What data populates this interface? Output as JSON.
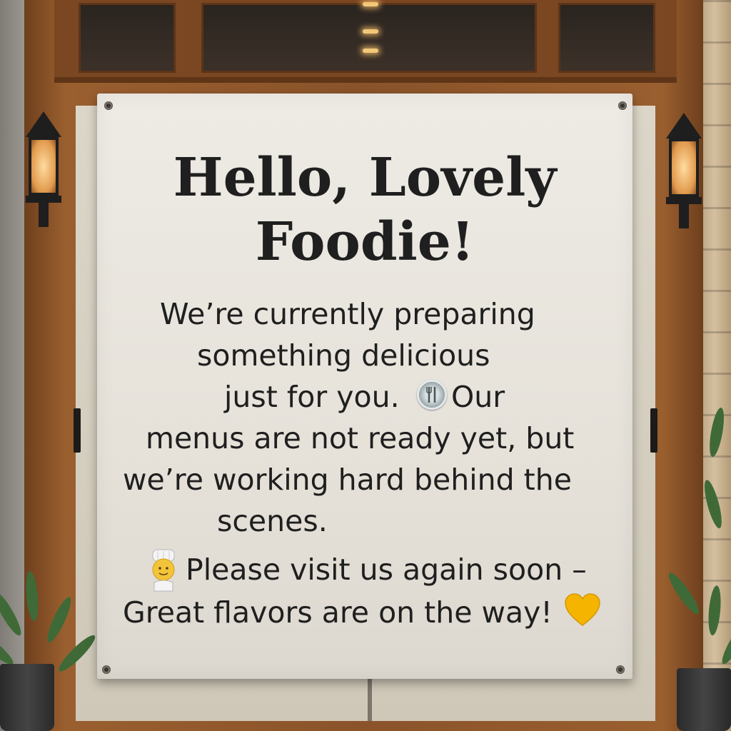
{
  "banner": {
    "headline_line1": "Hello, Lovely",
    "headline_line2": "Foodie!",
    "body_lines": [
      "We’re currently preparing",
      "something delicious",
      "just for you.",
      "Our",
      "menus are not ready yet, but",
      "we’re working hard behind the",
      "scenes.",
      "Please visit us again soon –",
      "Great flavors are on the way!"
    ],
    "emojis": [
      "plate-with-cutlery",
      "chef",
      "yellow-heart"
    ],
    "heart_color": "#f4b400"
  }
}
